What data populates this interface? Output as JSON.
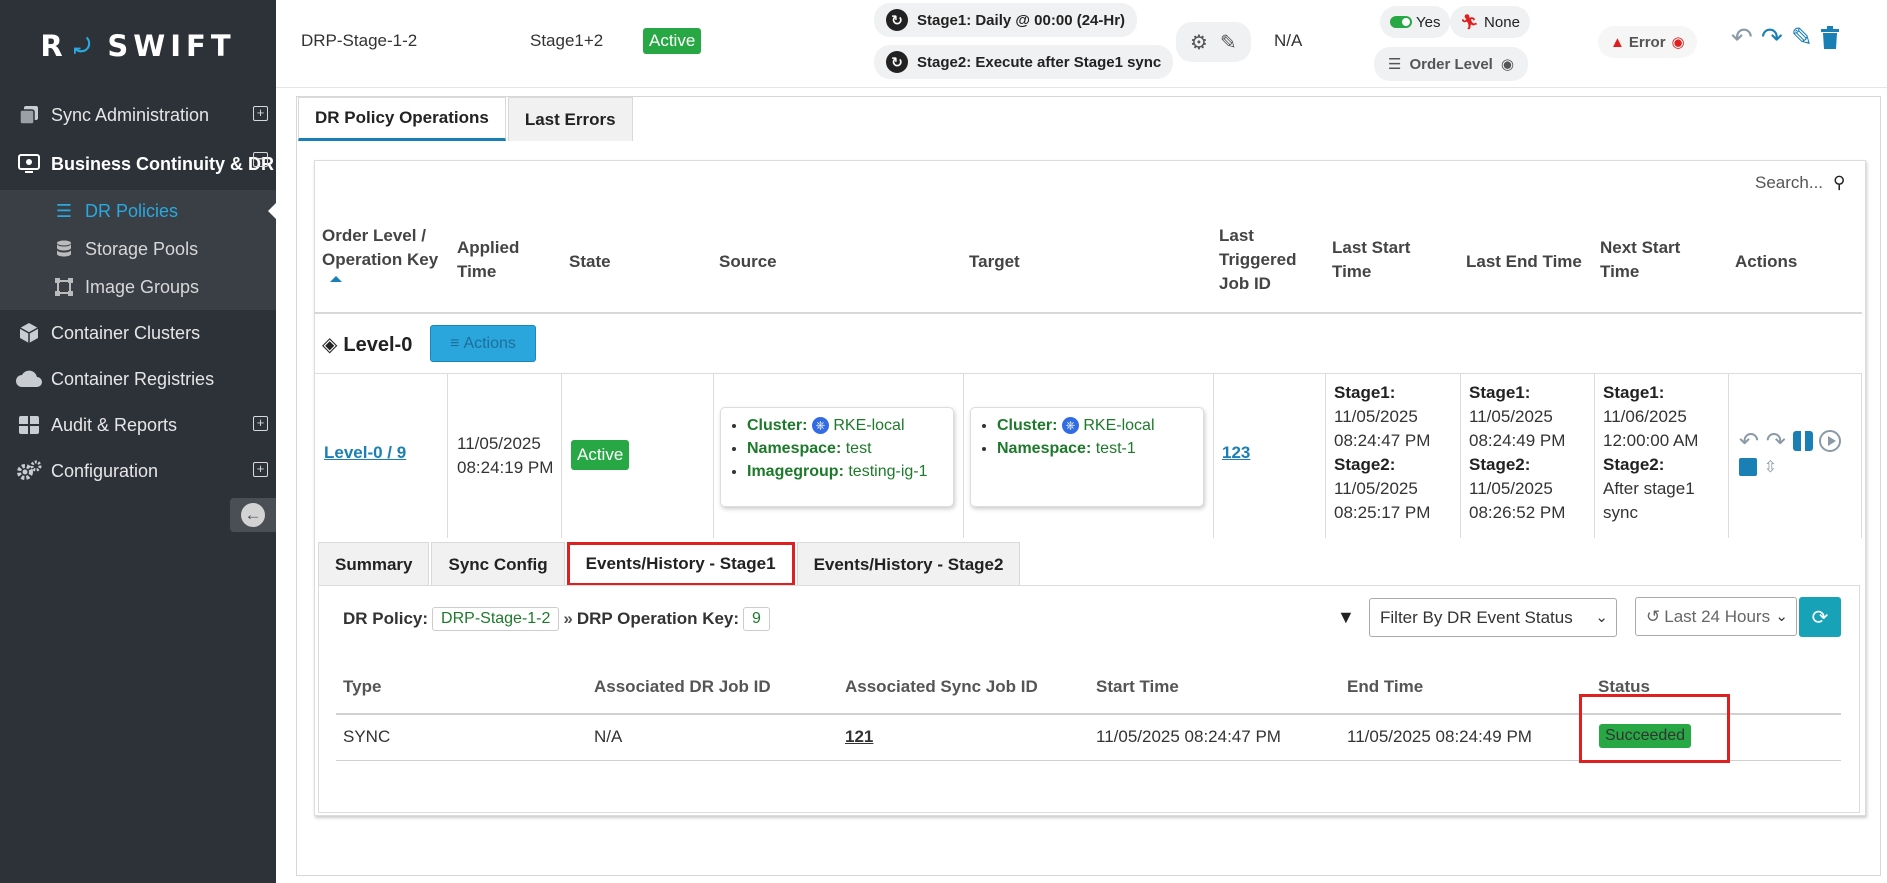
{
  "sidebar": {
    "logo_letter": "R",
    "logo_text": "SWIFT",
    "items": [
      {
        "label": "Sync Administration",
        "icon": "copy-icon",
        "expand": "⊞"
      },
      {
        "label": "Business Continuity & DR",
        "icon": "business-continuity-icon",
        "expand": "⊟"
      },
      {
        "label": "Container Clusters",
        "icon": "cube-icon"
      },
      {
        "label": "Container Registries",
        "icon": "cloud-icon"
      },
      {
        "label": "Audit & Reports",
        "icon": "grid-icon",
        "expand": "⊞"
      },
      {
        "label": "Configuration",
        "icon": "gears-icon",
        "expand": "⊞"
      }
    ],
    "subitems": [
      {
        "label": "DR Policies",
        "icon": "list-icon",
        "selected": true
      },
      {
        "label": "Storage Pools",
        "icon": "database-icon"
      },
      {
        "label": "Image Groups",
        "icon": "image-group-icon"
      }
    ]
  },
  "header": {
    "policy_name": "DRP-Stage-1-2",
    "stages": "Stage1+2",
    "state": "Active",
    "stage1_schedule": "Stage1: Daily @ 00:00 (24-Hr)",
    "stage2_schedule": "Stage2: Execute after Stage1 sync",
    "na": "N/A",
    "toggle_label": "Yes",
    "runner_label": "None",
    "order_level_label": "Order Level",
    "error_label": "Error"
  },
  "tabs": {
    "operations": "DR Policy Operations",
    "last_errors": "Last Errors"
  },
  "search": {
    "placeholder": "Search..."
  },
  "table": {
    "headers": {
      "order_level_1": "Order Level /",
      "order_level_2": "Operation Key",
      "applied_1": "Applied",
      "applied_2": "Time",
      "state": "State",
      "source": "Source",
      "target": "Target",
      "last_job_1": "Last",
      "last_job_2": "Triggered",
      "last_job_3": "Job ID",
      "last_start_1": "Last Start",
      "last_start_2": "Time",
      "last_end": "Last End Time",
      "next_start_1": "Next Start",
      "next_start_2": "Time",
      "actions": "Actions"
    },
    "level_title": "Level-0",
    "actions_button": "Actions",
    "row": {
      "key": "Level-0 / 9",
      "applied_date": "11/05/2025",
      "applied_time": "08:24:19 PM",
      "state": "Active",
      "source": {
        "cluster_label": "Cluster:",
        "cluster": "RKE-local",
        "namespace_label": "Namespace:",
        "namespace": "test",
        "imagegroup_label": "Imagegroup:",
        "imagegroup": "testing-ig-1"
      },
      "target": {
        "cluster_label": "Cluster:",
        "cluster": "RKE-local",
        "namespace_label": "Namespace:",
        "namespace": "test-1"
      },
      "last_job_id": "123",
      "stage1_label": "Stage1:",
      "stage2_label": "Stage2:",
      "last_start": {
        "s1_date": "11/05/2025",
        "s1_time": "08:24:47 PM",
        "s2_date": "11/05/2025",
        "s2_time": "08:25:17 PM"
      },
      "last_end": {
        "s1_date": "11/05/2025",
        "s1_time": "08:24:49 PM",
        "s2_date": "11/05/2025",
        "s2_time": "08:26:52 PM"
      },
      "next_start": {
        "s1_date": "11/06/2025",
        "s1_time": "12:00:00 AM",
        "s2_line1": "After stage1",
        "s2_line2": "sync"
      }
    }
  },
  "subtabs": {
    "summary": "Summary",
    "sync_config": "Sync Config",
    "events_stage1": "Events/History - Stage1",
    "events_stage2": "Events/History - Stage2"
  },
  "events": {
    "dr_policy_label": "DR Policy:",
    "dr_policy_value": "DRP-Stage-1-2",
    "op_key_label": "DRP Operation Key:",
    "op_key_value": "9",
    "status_filter": "Filter By DR Event Status",
    "time_filter": "Last 24 Hours",
    "headers": {
      "type": "Type",
      "dr_job": "Associated DR Job ID",
      "sync_job": "Associated Sync Job ID",
      "start": "Start Time",
      "end": "End Time",
      "status": "Status"
    },
    "row": {
      "type": "SYNC",
      "dr_job": "N/A",
      "sync_job": "121",
      "start": "11/05/2025 08:24:47 PM",
      "end": "11/05/2025 08:24:49 PM",
      "status": "Succeeded"
    }
  },
  "colors": {
    "accent": "#1a7fb5",
    "success": "#27a844",
    "sidebar": "#2d3238",
    "highlight": "#e02020"
  }
}
